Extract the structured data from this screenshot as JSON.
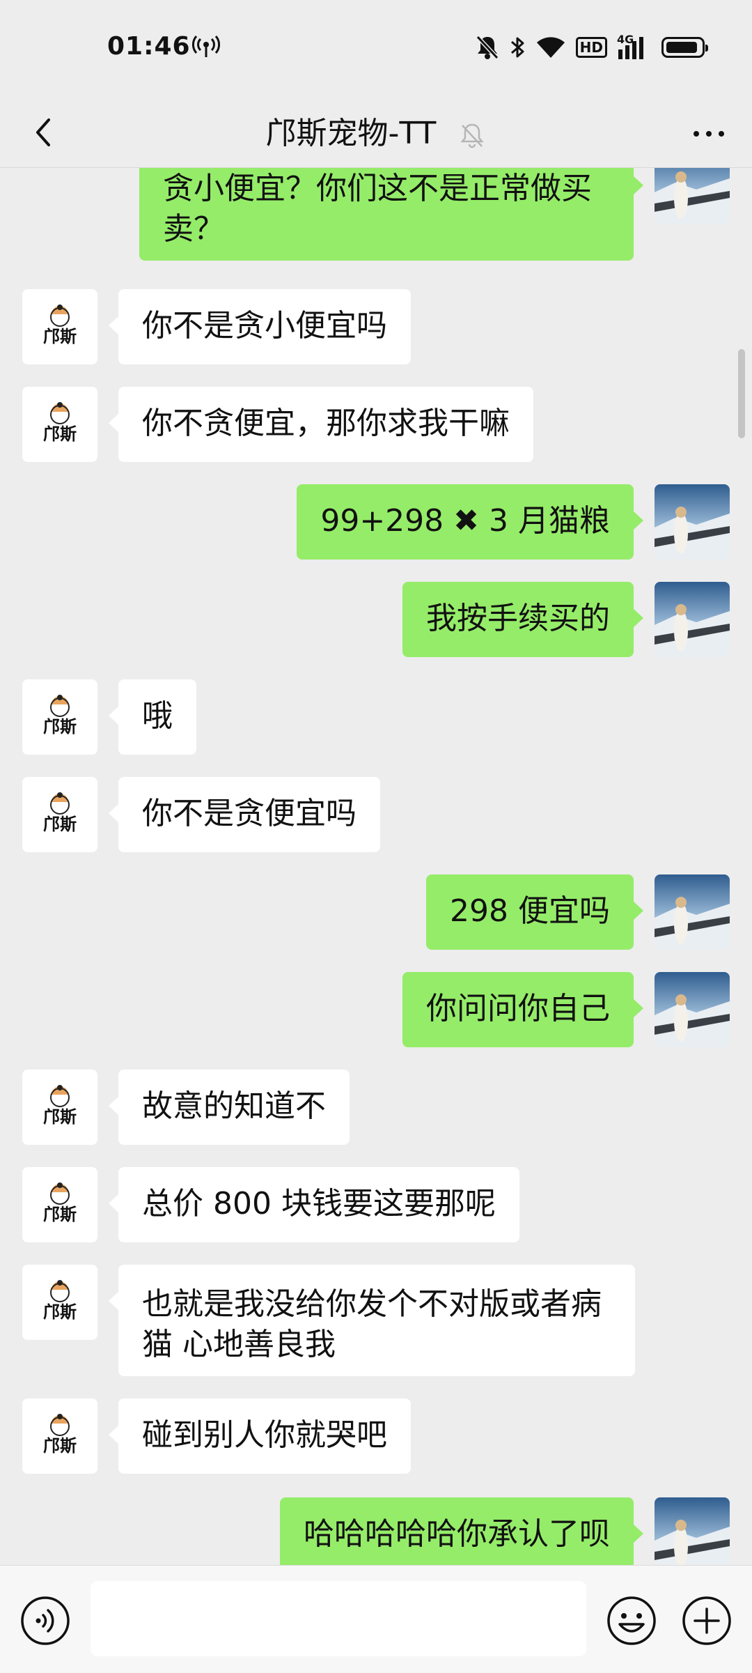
{
  "status_bar": {
    "time": "01:46",
    "hd_label": "HD",
    "network_label": "4G"
  },
  "header": {
    "title": "邝斯宠物-TT"
  },
  "shop_avatar": {
    "logo_text": "邝斯"
  },
  "messages": [
    {
      "sender": "me",
      "text": "贪小便宜？你们这不是正常做买卖？"
    },
    {
      "sender": "shop",
      "text": "你不是贪小便宜吗"
    },
    {
      "sender": "shop",
      "text": "你不贪便宜，那你求我干嘛"
    },
    {
      "sender": "me",
      "text": "99+298 ✖ 3 月猫粮"
    },
    {
      "sender": "me",
      "text": "我按手续买的"
    },
    {
      "sender": "shop",
      "text": "哦"
    },
    {
      "sender": "shop",
      "text": "你不是贪便宜吗"
    },
    {
      "sender": "me",
      "text": "298 便宜吗"
    },
    {
      "sender": "me",
      "text": "你问问你自己"
    },
    {
      "sender": "shop",
      "text": "故意的知道不"
    },
    {
      "sender": "shop",
      "text": "总价 800 块钱要这要那呢"
    },
    {
      "sender": "shop",
      "text": "也就是我没给你发个不对版或者病猫 心地善良我"
    },
    {
      "sender": "shop",
      "text": "碰到别人你就哭吧"
    },
    {
      "sender": "me",
      "text": "哈哈哈哈哈你承认了呗"
    }
  ],
  "input": {
    "placeholder": ""
  },
  "colors": {
    "background": "#ededed",
    "outgoing_bubble": "#95ec69",
    "incoming_bubble": "#ffffff"
  }
}
